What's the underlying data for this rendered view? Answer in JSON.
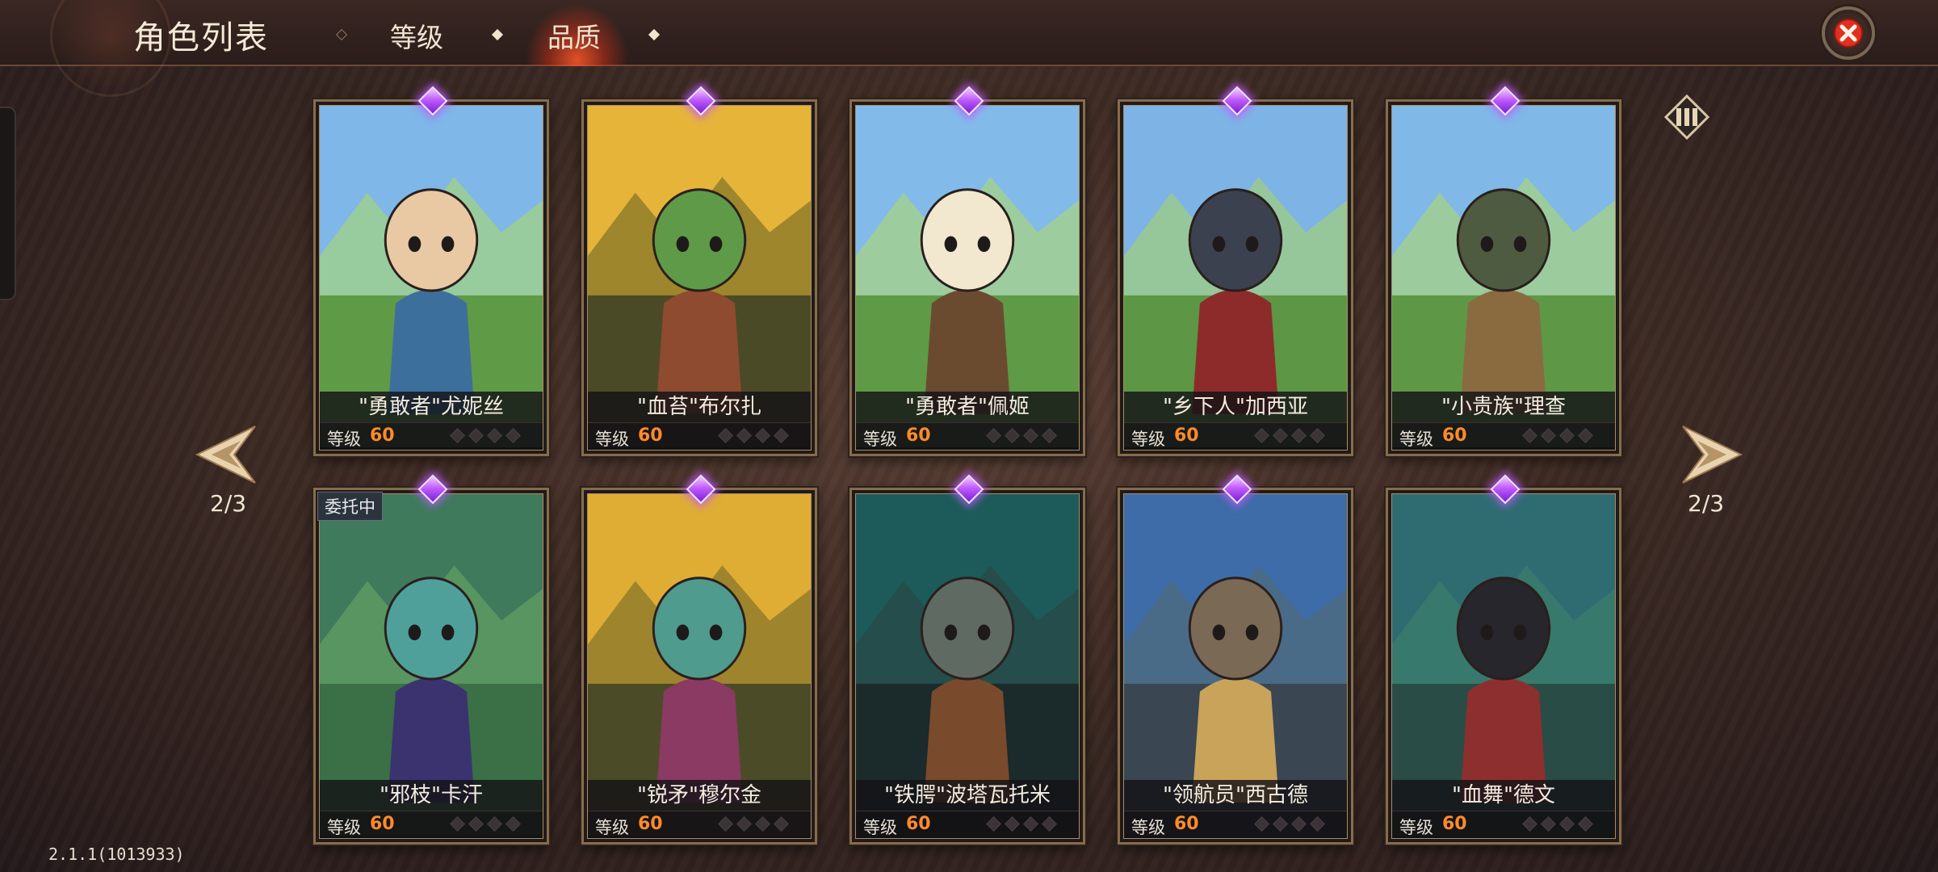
{
  "header": {
    "title": "角色列表",
    "tabs": [
      {
        "label": "等级",
        "active": false
      },
      {
        "label": "品质",
        "active": true
      }
    ],
    "close_icon": "close-x-icon"
  },
  "pagination": {
    "left_label": "2/3",
    "right_label": "2/3"
  },
  "level_label": "等级",
  "characters": [
    {
      "name": "\"勇敢者\"尤妮丝",
      "level": "60",
      "rarity": "epic",
      "stars": 4,
      "badge": ""
    },
    {
      "name": "\"血苔\"布尔扎",
      "level": "60",
      "rarity": "epic",
      "stars": 4,
      "badge": ""
    },
    {
      "name": "\"勇敢者\"佩姬",
      "level": "60",
      "rarity": "epic",
      "stars": 4,
      "badge": ""
    },
    {
      "name": "\"乡下人\"加西亚",
      "level": "60",
      "rarity": "epic",
      "stars": 4,
      "badge": ""
    },
    {
      "name": "\"小贵族\"理查",
      "level": "60",
      "rarity": "epic",
      "stars": 4,
      "badge": ""
    },
    {
      "name": "\"邪枝\"卡汗",
      "level": "60",
      "rarity": "epic",
      "stars": 4,
      "badge": "委托中"
    },
    {
      "name": "\"锐矛\"穆尔金",
      "level": "60",
      "rarity": "epic",
      "stars": 4,
      "badge": ""
    },
    {
      "name": "\"铁腭\"波塔瓦托米",
      "level": "60",
      "rarity": "epic",
      "stars": 4,
      "badge": ""
    },
    {
      "name": "\"领航员\"西古德",
      "level": "60",
      "rarity": "epic",
      "stars": 4,
      "badge": ""
    },
    {
      "name": "\"血舞\"德文",
      "level": "60",
      "rarity": "epic",
      "stars": 4,
      "badge": ""
    }
  ],
  "version": "2.1.1(1013933)",
  "colors": {
    "accent_level": "#ff8a2a",
    "gem_purple": "#c05cff",
    "close_red": "#e0301e",
    "frame_gold": "#8a6b48"
  }
}
